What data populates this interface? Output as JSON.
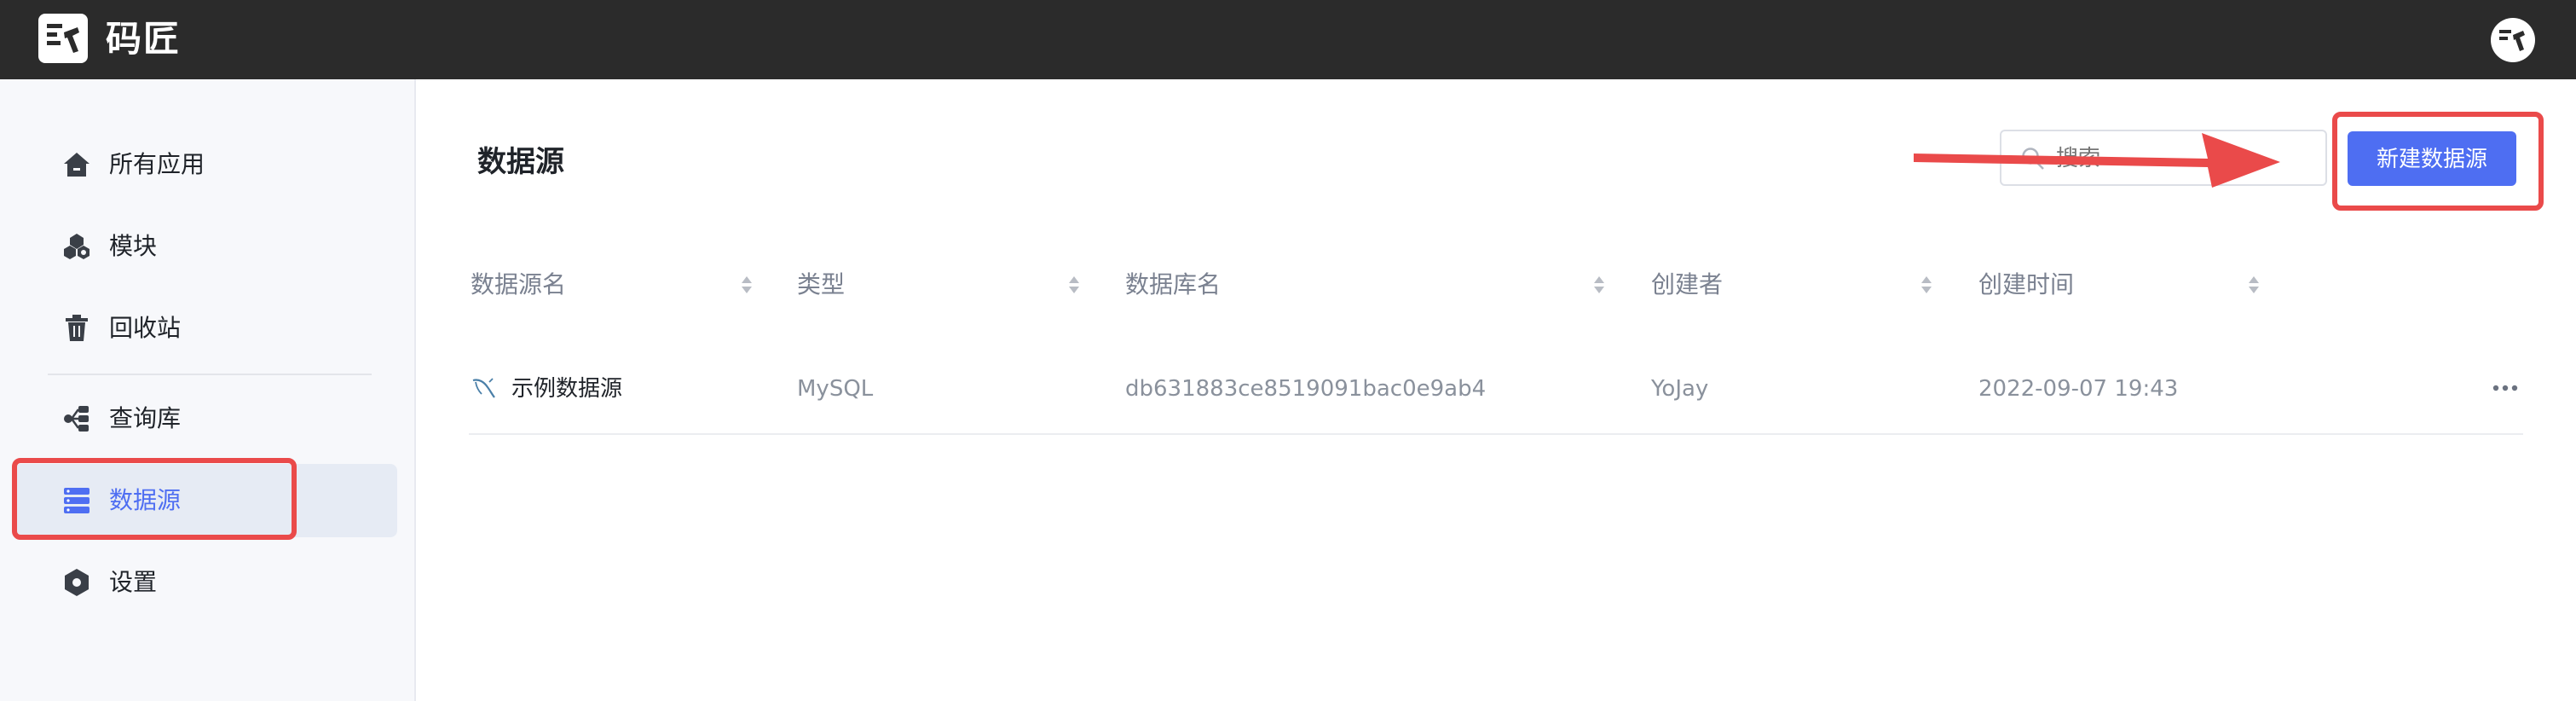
{
  "app": {
    "name": "码匠"
  },
  "sidebar": {
    "items": [
      {
        "label": "所有应用",
        "icon": "home-icon"
      },
      {
        "label": "模块",
        "icon": "modules-icon"
      },
      {
        "label": "回收站",
        "icon": "trash-icon"
      },
      {
        "label": "查询库",
        "icon": "query-library-icon"
      },
      {
        "label": "数据源",
        "icon": "datasource-icon",
        "active": true
      },
      {
        "label": "设置",
        "icon": "settings-icon"
      }
    ]
  },
  "main": {
    "title": "数据源",
    "search": {
      "value": "",
      "placeholder": "搜索"
    },
    "new_button_label": "新建数据源",
    "table": {
      "columns": [
        "数据源名",
        "类型",
        "数据库名",
        "创建者",
        "创建时间"
      ],
      "rows": [
        {
          "name": "示例数据源",
          "type": "MySQL",
          "database": "db631883ce8519091bac0e9ab4",
          "creator": "YoJay",
          "created_at": "2022-09-07 19:43",
          "icon": "mysql-icon"
        }
      ]
    }
  },
  "colors": {
    "accent": "#4e6ef2",
    "topbar": "#2b2b2b",
    "annotation": "#ea4a4a"
  }
}
